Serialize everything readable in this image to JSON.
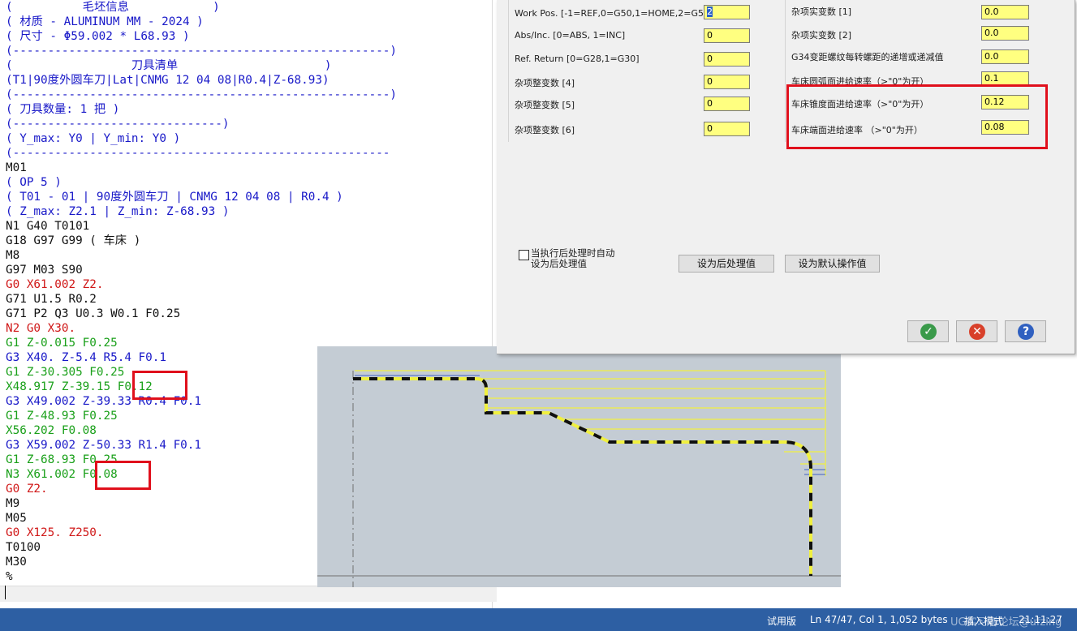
{
  "editor": {
    "lines": [
      {
        "text": "(          毛坯信息            )",
        "color": "blue"
      },
      {
        "text": "( 材质 - ALUMINUM MM - 2024 )",
        "color": "blue"
      },
      {
        "text": "( 尺寸 - Φ59.002 * L68.93 )",
        "color": "blue"
      },
      {
        "text": "(------------------------------------------------------)",
        "color": "blue"
      },
      {
        "text": "(                 刀具清单                     )",
        "color": "blue"
      },
      {
        "text": "(T1|90度外圆车刀|Lat|CNMG 12 04 08|R0.4|Z-68.93)",
        "color": "blue"
      },
      {
        "text": "(------------------------------------------------------)",
        "color": "blue"
      },
      {
        "text": "( 刀具数量: 1 把 )",
        "color": "blue"
      },
      {
        "text": "(------------------------------)",
        "color": "blue"
      },
      {
        "text": "( Y_max: Y0 | Y_min: Y0 )",
        "color": "blue"
      },
      {
        "text": "(------------------------------------------------------",
        "color": "blue"
      },
      {
        "text": "M01",
        "color": "black"
      },
      {
        "text": "( OP 5 )",
        "color": "blue"
      },
      {
        "text": "( T01 - 01 | 90度外圆车刀 | CNMG 12 04 08 | R0.4 )",
        "color": "blue"
      },
      {
        "text": "( Z_max: Z2.1 | Z_min: Z-68.93 )",
        "color": "blue"
      },
      {
        "text": "N1 G40 T0101",
        "color": "black"
      },
      {
        "text": "G18 G97 G99 ( 车床 )",
        "color": "black"
      },
      {
        "text": "M8",
        "color": "black"
      },
      {
        "text": "G97 M03 S90",
        "color": "black"
      },
      {
        "text": "G0 X61.002 Z2.",
        "color": "red"
      },
      {
        "text": "G71 U1.5 R0.2",
        "color": "black"
      },
      {
        "text": "G71 P2 Q3 U0.3 W0.1 F0.25",
        "color": "black"
      },
      {
        "text": "N2 G0 X30.",
        "color": "red"
      },
      {
        "text": "G1 Z-0.015 F0.25",
        "color": "green"
      },
      {
        "text": "G3 X40. Z-5.4 R5.4 F0.1",
        "color": "blue"
      },
      {
        "text": "G1 Z-30.305 F0.25",
        "color": "green"
      },
      {
        "text": "X48.917 Z-39.15 F0.12",
        "color": "green"
      },
      {
        "text": "G3 X49.002 Z-39.33 R0.4 F0.1",
        "color": "blue"
      },
      {
        "text": "G1 Z-48.93 F0.25",
        "color": "green"
      },
      {
        "text": "X56.202 F0.08",
        "color": "green"
      },
      {
        "text": "G3 X59.002 Z-50.33 R1.4 F0.1",
        "color": "blue"
      },
      {
        "text": "G1 Z-68.93 F0.25",
        "color": "green"
      },
      {
        "text": "N3 X61.002 F0.08",
        "color": "green"
      },
      {
        "text": "G0 Z2.",
        "color": "red"
      },
      {
        "text": "M9",
        "color": "black"
      },
      {
        "text": "M05",
        "color": "black"
      },
      {
        "text": "G0 X125. Z250.",
        "color": "red"
      },
      {
        "text": "T0100",
        "color": "black"
      },
      {
        "text": "M30",
        "color": "black"
      },
      {
        "text": "%",
        "color": "black"
      }
    ]
  },
  "dialog": {
    "left_fields": [
      {
        "label": "Work Pos. [-1=REF,0=G50,1=HOME,2=G54s]",
        "value": "2",
        "selected": true
      },
      {
        "label": "Abs/Inc. [0=ABS, 1=INC]",
        "value": "0"
      },
      {
        "label": "Ref. Return [0=G28,1=G30]",
        "value": "0"
      },
      {
        "label": "杂项整变数 [4]",
        "value": "0"
      },
      {
        "label": "杂项整变数 [5]",
        "value": "0"
      },
      {
        "label": "杂项整变数 [6]",
        "value": "0"
      }
    ],
    "right_fields": [
      {
        "label": "杂项实变数 [1]",
        "value": "0.0"
      },
      {
        "label": "杂项实变数 [2]",
        "value": "0.0"
      },
      {
        "label": "G34变距螺纹每转螺距的递增或递减值",
        "value": "0.0"
      },
      {
        "label": "车床圆弧面进给速率（>\"0\"为开）",
        "value": "0.1"
      },
      {
        "label": "车床锥度面进给速率（>\"0\"为开）",
        "value": "0.12"
      },
      {
        "label": "车床端面进给速率 （>\"0\"为开）",
        "value": "0.08"
      }
    ],
    "checkbox_label_1": "当执行后处理时自动",
    "checkbox_label_2": "设为后处理值",
    "checkbox_checked": false,
    "btn_set_post": "设为后处理值",
    "btn_set_default": "设为默认操作值",
    "icons": [
      "ok-icon",
      "cancel-icon",
      "help-icon"
    ]
  },
  "statusbar": {
    "trial": "试用版",
    "position": "Ln 47/47, Col 1, 1,052 bytes",
    "mode": "插入模式",
    "time": "21:11:27",
    "watermark": "UG实习者论坛@ufzing"
  },
  "colors": {
    "code_blue": "#1818c8",
    "code_red": "#d01818",
    "code_green": "#1aa01a",
    "input_yellow": "#ffff80",
    "highlight_red": "#e0101c",
    "status_blue": "#2d5fa3"
  }
}
